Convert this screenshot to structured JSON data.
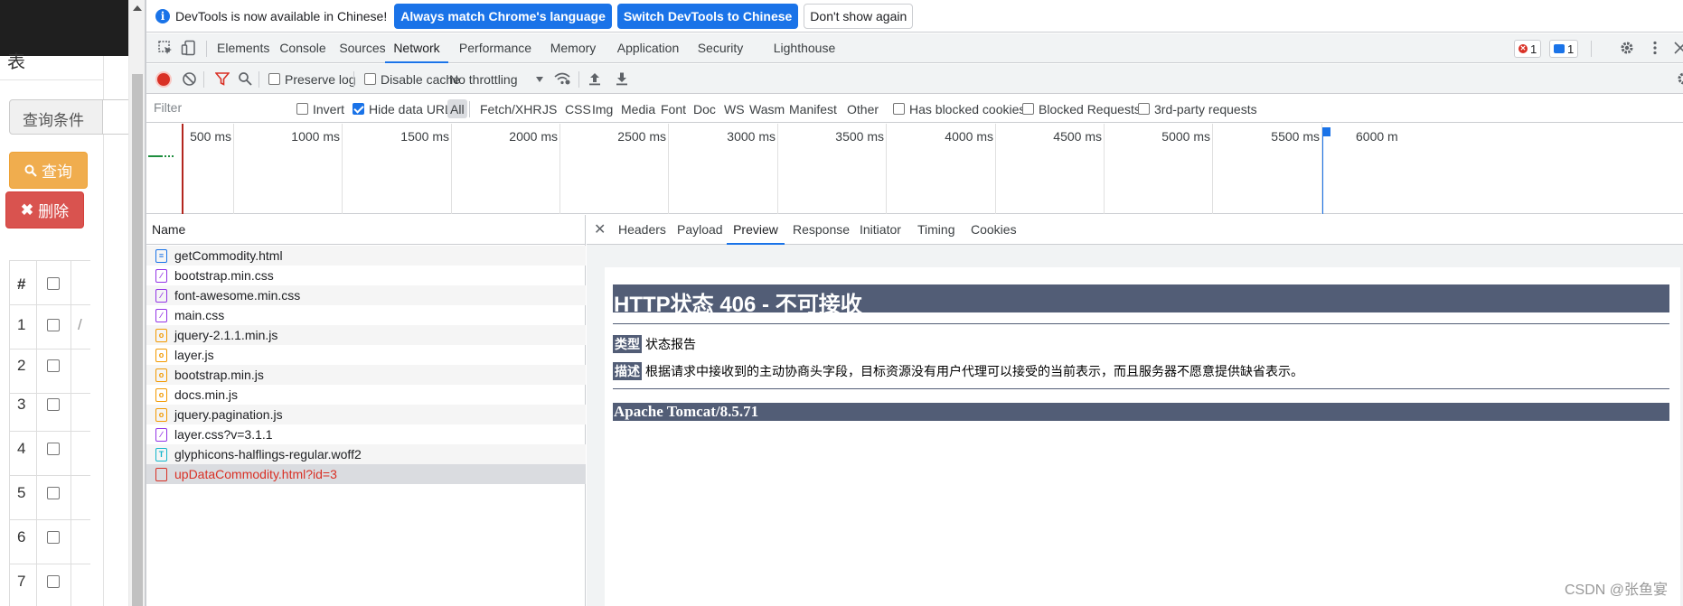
{
  "page": {
    "top_char": "表",
    "query_condition_label": "查询条件",
    "search_button": "查询",
    "delete_button": "删除",
    "table_header_hash": "#",
    "row_numbers": [
      "1",
      "2",
      "3",
      "4",
      "5",
      "6",
      "7"
    ],
    "row1_fragment": "/"
  },
  "infobar": {
    "message": "DevTools is now available in Chinese!",
    "btn_match": "Always match Chrome's language",
    "btn_switch": "Switch DevTools to Chinese",
    "btn_dismiss": "Don't show again"
  },
  "tabs": {
    "items": [
      "Elements",
      "Console",
      "Sources",
      "Network",
      "Performance",
      "Memory",
      "Application",
      "Security",
      "Lighthouse"
    ],
    "active": "Network",
    "error_count": "1",
    "message_count": "1"
  },
  "toolbar": {
    "preserve_log": "Preserve log",
    "disable_cache": "Disable cache",
    "throttling": "No throttling"
  },
  "filterbar": {
    "placeholder": "Filter",
    "invert": "Invert",
    "hide_data_urls": "Hide data URLs",
    "types": [
      "All",
      "Fetch/XHR",
      "JS",
      "CSS",
      "Img",
      "Media",
      "Font",
      "Doc",
      "WS",
      "Wasm",
      "Manifest",
      "Other"
    ],
    "has_blocked_cookies": "Has blocked cookies",
    "blocked_requests": "Blocked Requests",
    "third_party": "3rd-party requests"
  },
  "timeline": {
    "labels": [
      "500 ms",
      "1000 ms",
      "1500 ms",
      "2000 ms",
      "2500 ms",
      "3000 ms",
      "3500 ms",
      "4000 ms",
      "4500 ms",
      "5000 ms",
      "5500 ms",
      "6000 m"
    ]
  },
  "requests": {
    "header": "Name",
    "items": [
      {
        "name": "getCommodity.html",
        "type": "doc"
      },
      {
        "name": "bootstrap.min.css",
        "type": "css"
      },
      {
        "name": "font-awesome.min.css",
        "type": "css"
      },
      {
        "name": "main.css",
        "type": "css"
      },
      {
        "name": "jquery-2.1.1.min.js",
        "type": "js"
      },
      {
        "name": "layer.js",
        "type": "js"
      },
      {
        "name": "bootstrap.min.js",
        "type": "js"
      },
      {
        "name": "docs.min.js",
        "type": "js"
      },
      {
        "name": "jquery.pagination.js",
        "type": "js"
      },
      {
        "name": "layer.css?v=3.1.1",
        "type": "css"
      },
      {
        "name": "glyphicons-halflings-regular.woff2",
        "type": "font"
      },
      {
        "name": "upDataCommodity.html?id=3",
        "type": "bad"
      }
    ]
  },
  "detail": {
    "tabs": [
      "Headers",
      "Payload",
      "Preview",
      "Response",
      "Initiator",
      "Timing",
      "Cookies"
    ],
    "active": "Preview",
    "title": "HTTP状态 406 - 不可接收",
    "type_label": "类型",
    "type_value": "状态报告",
    "desc_label": "描述",
    "desc_value": "根据请求中接收到的主动协商头字段，目标资源没有用户代理可以接受的当前表示，而且服务器不愿意提供缺省表示。",
    "server": "Apache Tomcat/8.5.71",
    "watermark": "CSDN @张鱼宴"
  }
}
